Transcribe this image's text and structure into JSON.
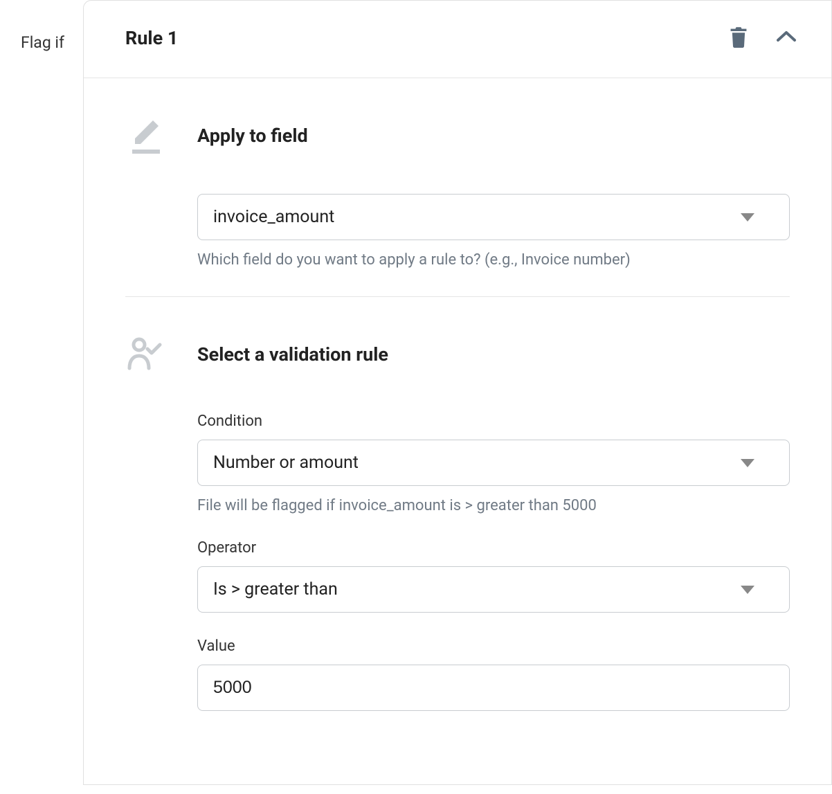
{
  "sideLabel": "Flag if",
  "rule": {
    "title": "Rule 1"
  },
  "applyToField": {
    "heading": "Apply to field",
    "selectedValue": "invoice_amount",
    "helper": "Which field do you want to apply a rule to? (e.g., Invoice number)"
  },
  "validationRule": {
    "heading": "Select a validation rule",
    "condition": {
      "label": "Condition",
      "selectedValue": "Number or amount",
      "helper": "File will be flagged if invoice_amount is > greater than 5000"
    },
    "operator": {
      "label": "Operator",
      "selectedValue": "Is > greater than"
    },
    "value": {
      "label": "Value",
      "value": "5000"
    }
  }
}
